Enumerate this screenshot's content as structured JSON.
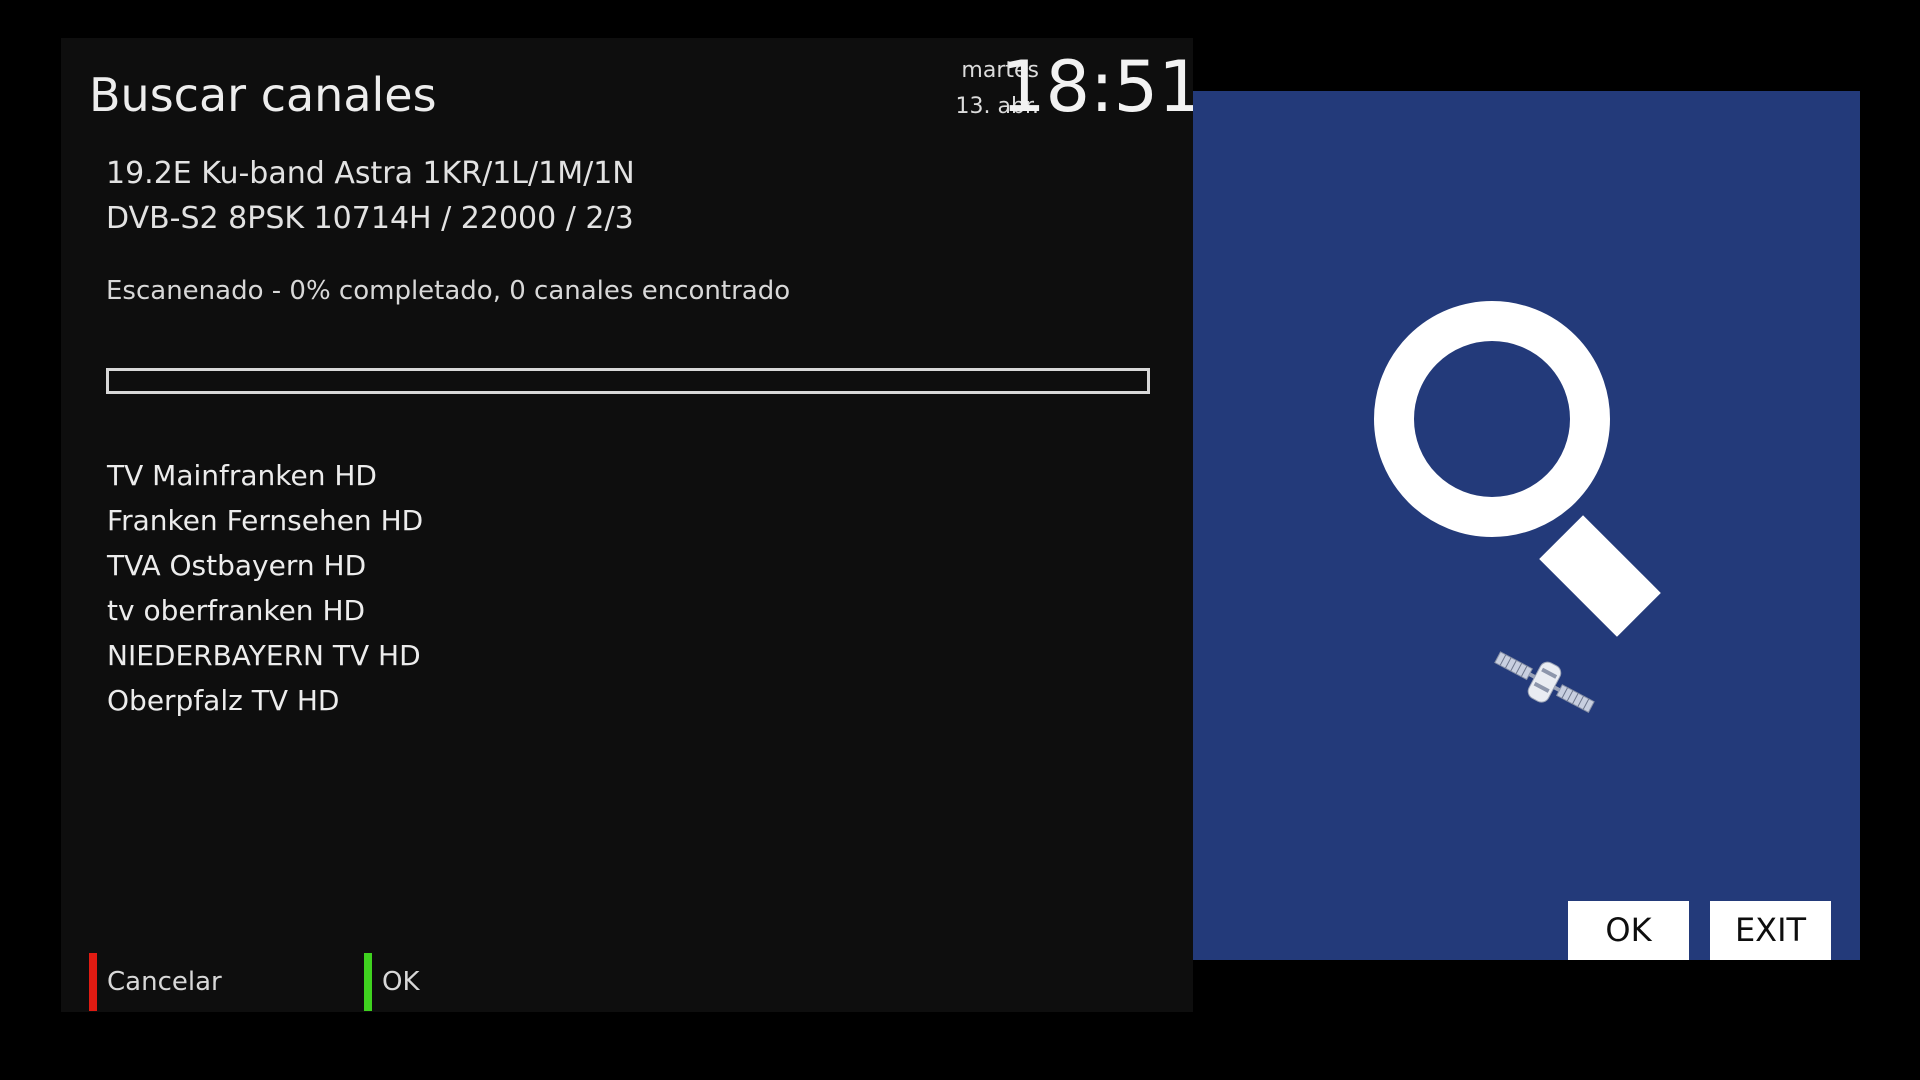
{
  "header": {
    "title": "Buscar canales",
    "day": "martes",
    "date": "13. abr.",
    "time": "18:51"
  },
  "transponder": {
    "satellite": "19.2E Ku-band Astra 1KR/1L/1M/1N",
    "tuning": "DVB-S2 8PSK 10714H / 22000 / 2/3"
  },
  "scan": {
    "status": "Escanenado - 0% completado, 0 canales encontrado",
    "progress_percent": 0
  },
  "channels": [
    "TV Mainfranken HD",
    "Franken Fernsehen HD",
    "TVA Ostbayern HD",
    "tv oberfranken HD",
    "NIEDERBAYERN TV HD",
    "Oberpfalz TV HD"
  ],
  "footer": {
    "red_label": "Cancelar",
    "green_label": "OK"
  },
  "side_panel": {
    "ok_label": "OK",
    "exit_label": "EXIT",
    "icons": [
      "magnifier-icon",
      "satellite-icon"
    ]
  },
  "colors": {
    "panel_bg": "#0e0e0e",
    "side_bg": "#233a7a",
    "red_key": "#e01b12",
    "green_key": "#3fd21f"
  }
}
